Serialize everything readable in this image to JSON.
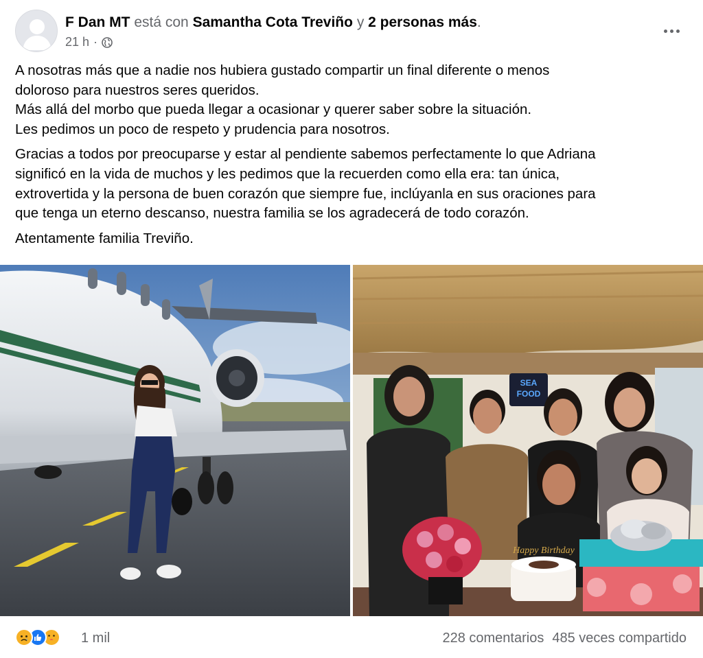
{
  "post": {
    "author": "F Dan MT",
    "with_text": "está con",
    "tagged": "Samantha Cota Treviño",
    "and_text": "y",
    "others": "2 personas más",
    "period": ".",
    "time": "21 h",
    "separator": "·",
    "privacy_icon": "globe-icon",
    "more_icon": "more-options-icon"
  },
  "body": {
    "paragraph1": [
      "A nosotras más que a nadie nos hubiera gustado compartir un final diferente o menos",
      "doloroso para nuestros seres queridos.",
      "Más allá del morbo que pueda llegar a ocasionar y querer saber sobre la situación.",
      "Les pedimos un poco de respeto y prudencia para nosotros."
    ],
    "paragraph2": [
      "Gracias a todos por preocuparse y estar al pendiente sabemos perfectamente lo que Adriana",
      "significó en la vida de muchos y les pedimos que la recuerden como ella era: tan única,",
      "extrovertida y la persona de buen corazón que siempre fue, inclúyanla en sus oraciones para",
      "que tenga un eterno descanso, nuestra familia se los agradecerá de todo corazón."
    ],
    "paragraph3": "Atentamente familia Treviño."
  },
  "photos": {
    "left": {
      "icon": "photo-woman-jet"
    },
    "right": {
      "icon": "photo-birthday-group",
      "sign_text_1": "SEA",
      "sign_text_2": "FOOD",
      "cake_text": "Happy Birthday"
    }
  },
  "footer": {
    "reaction_icons": [
      "sad-reaction-icon",
      "like-reaction-icon",
      "care-reaction-icon"
    ],
    "reaction_count": "1 mil",
    "comments": "228 comentarios",
    "shares": "485 veces compartido"
  },
  "colors": {
    "text": "#050505",
    "muted": "#65676b",
    "like_blue": "#1877f2",
    "reaction_yellow": "#f7b125"
  }
}
